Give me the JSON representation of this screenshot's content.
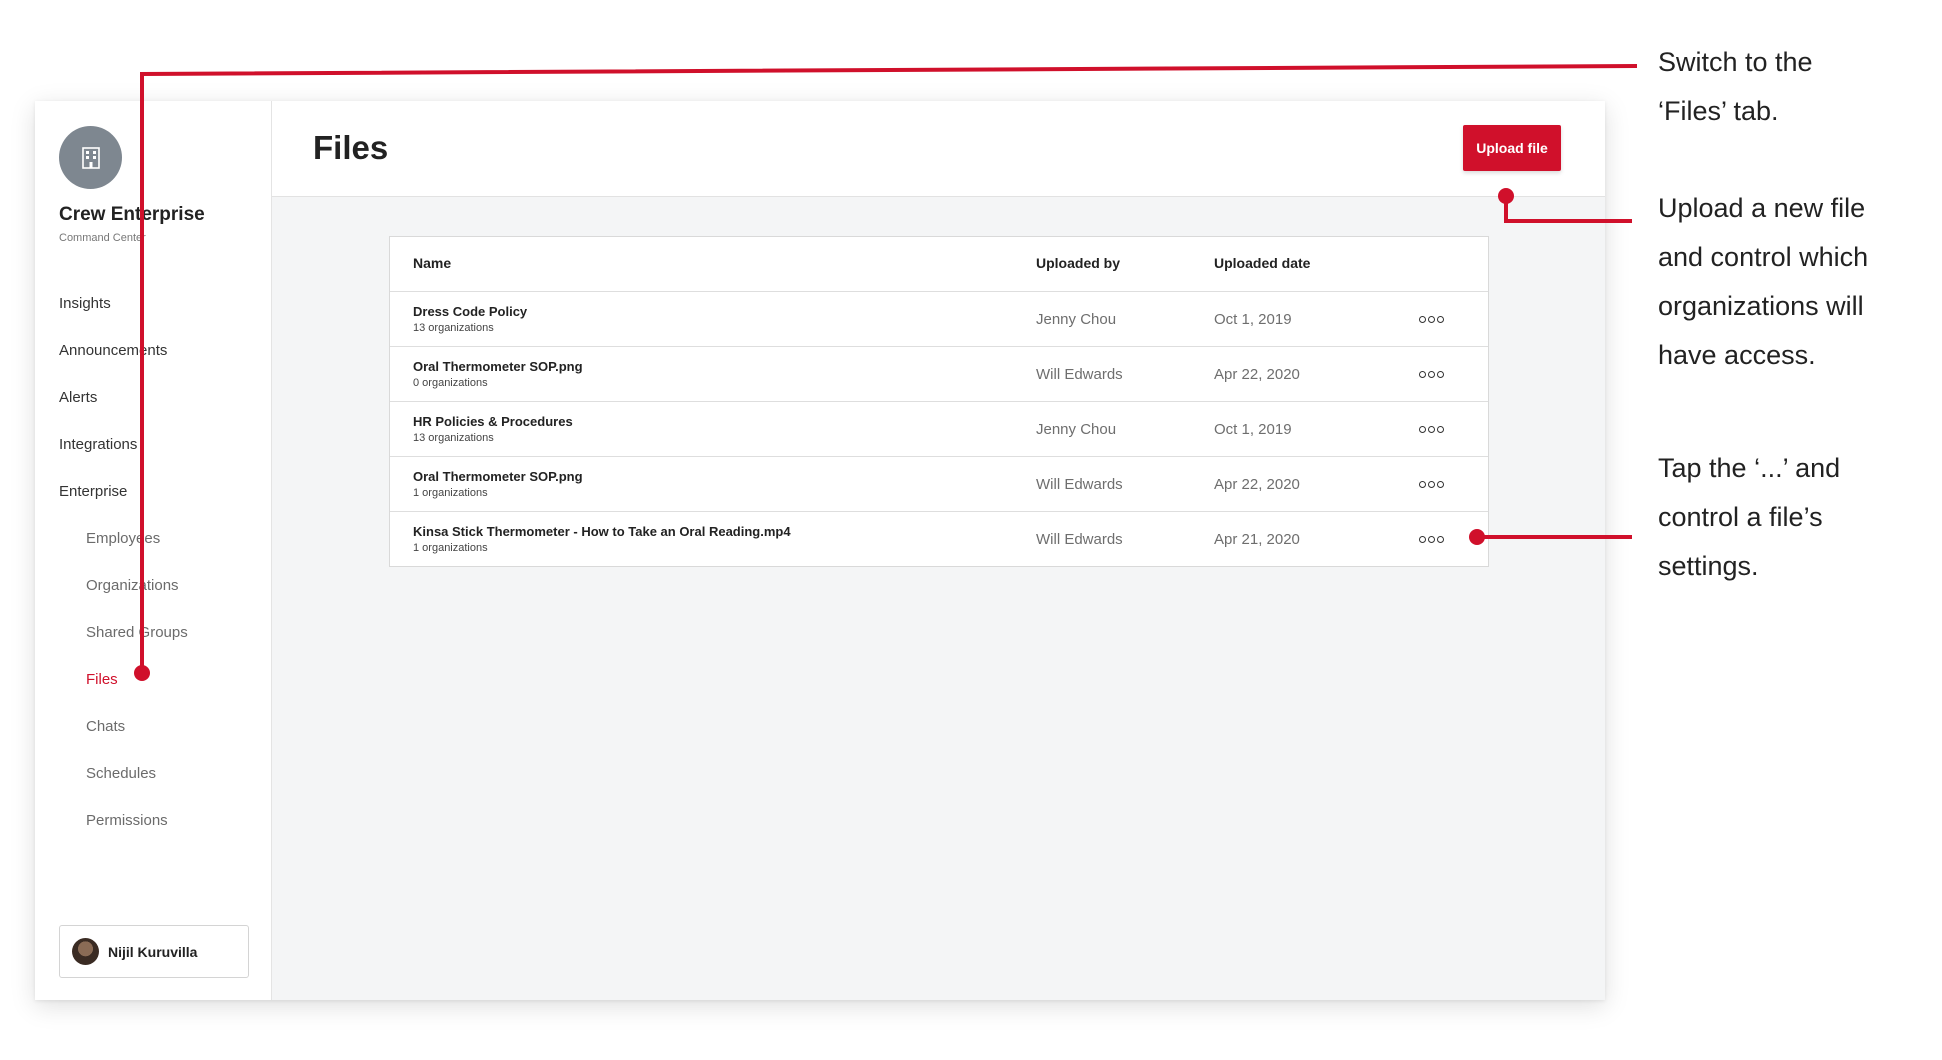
{
  "sidebar": {
    "org_name": "Crew Enterprise",
    "org_subtitle": "Command Center",
    "org_icon": "building-icon",
    "nav": [
      {
        "label": "Insights"
      },
      {
        "label": "Announcements"
      },
      {
        "label": "Alerts"
      },
      {
        "label": "Integrations"
      },
      {
        "label": "Enterprise"
      }
    ],
    "enterprise_sub": [
      {
        "label": "Employees"
      },
      {
        "label": "Organizations"
      },
      {
        "label": "Shared Groups"
      },
      {
        "label": "Files",
        "active": true
      },
      {
        "label": "Chats"
      },
      {
        "label": "Schedules"
      },
      {
        "label": "Permissions"
      }
    ],
    "user": {
      "name": "Nijil Kuruvilla"
    }
  },
  "main": {
    "title": "Files",
    "upload_label": "Upload file",
    "table": {
      "headers": {
        "name": "Name",
        "uploaded_by": "Uploaded by",
        "uploaded_date": "Uploaded date"
      },
      "rows": [
        {
          "name": "Dress Code Policy",
          "orgs": "13 organizations",
          "uploaded_by": "Jenny Chou",
          "date": "Oct 1, 2019"
        },
        {
          "name": "Oral Thermometer SOP.png",
          "orgs": "0 organizations",
          "uploaded_by": "Will Edwards",
          "date": "Apr 22, 2020"
        },
        {
          "name": "HR Policies & Procedures",
          "orgs": "13 organizations",
          "uploaded_by": "Jenny Chou",
          "date": "Oct 1, 2019"
        },
        {
          "name": "Oral Thermometer SOP.png",
          "orgs": "1 organizations",
          "uploaded_by": "Will Edwards",
          "date": "Apr 22, 2020"
        },
        {
          "name": "Kinsa Stick Thermometer - How to Take an Oral Reading.mp4",
          "orgs": "1 organizations",
          "uploaded_by": "Will Edwards",
          "date": "Apr 21, 2020"
        }
      ]
    }
  },
  "annotations": {
    "accent_color": "#d0102b",
    "files_tab": [
      "Switch to the",
      "‘Files’ tab."
    ],
    "upload": [
      "Upload a new file",
      "and control which",
      "organizations will",
      "have access."
    ],
    "settings": [
      "Tap the ‘...’ and",
      "control a file’s",
      "settings."
    ]
  }
}
